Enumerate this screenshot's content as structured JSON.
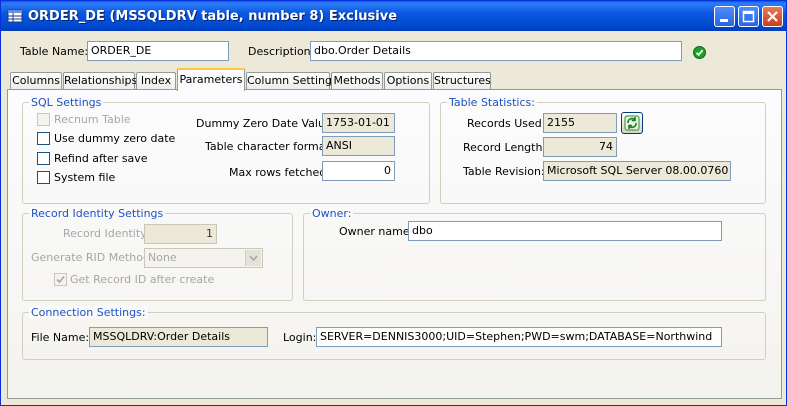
{
  "window": {
    "title": "ORDER_DE  (MSSQLDRV table, number 8)  Exclusive",
    "icon": "table-icon",
    "controls": [
      "minimize-icon",
      "maximize-icon",
      "close-icon"
    ]
  },
  "header": {
    "table_name_label": "Table Name:",
    "table_name_value": "ORDER_DE",
    "description_label": "Description:",
    "description_value": "dbo.Order Details",
    "status_icon": "check-circle-icon",
    "status_color": "#1E9E2A"
  },
  "tabs": [
    {
      "label": "Columns"
    },
    {
      "label": "Relationships"
    },
    {
      "label": "Index"
    },
    {
      "label": "Parameters",
      "active": true
    },
    {
      "label": "Column Settings"
    },
    {
      "label": "Methods"
    },
    {
      "label": "Options"
    },
    {
      "label": "Structures"
    }
  ],
  "sql_settings": {
    "title": "SQL Settings",
    "recnum_table": {
      "label": "Recnum Table",
      "checked": false,
      "disabled": true
    },
    "use_dummy_zero_date": {
      "label": "Use dummy zero date",
      "checked": false
    },
    "refind_after_save": {
      "label": "Refind after save",
      "checked": false
    },
    "system_file": {
      "label": "System file",
      "checked": false
    },
    "dummy_zero_date_label": "Dummy Zero Date Value:",
    "dummy_zero_date_value": "1753-01-01",
    "table_char_format_label": "Table character format:",
    "table_char_format_value": "ANSI",
    "max_rows_label": "Max rows fetched:",
    "max_rows_value": "0"
  },
  "table_statistics": {
    "title": "Table Statistics:",
    "records_used_label": "Records Used:",
    "records_used_value": "2155",
    "refresh_icon": "refresh-icon",
    "record_length_label": "Record Length:",
    "record_length_value": "74",
    "table_revision_label": "Table Revision:",
    "table_revision_value": "Microsoft SQL Server 08.00.0760"
  },
  "record_identity": {
    "title": "Record Identity Settings",
    "record_identity_label": "Record Identity:",
    "record_identity_value": "1",
    "generate_rid_label": "Generate RID Method",
    "generate_rid_value": "None",
    "get_record_id": {
      "label": "Get Record ID after create",
      "checked": true,
      "disabled": true
    }
  },
  "owner": {
    "title": "Owner:",
    "owner_name_label": "Owner name:",
    "owner_name_value": "dbo"
  },
  "connection": {
    "title": "Connection Settings:",
    "file_name_label": "File Name:",
    "file_name_value": "MSSQLDRV:Order Details",
    "login_label": "Login:",
    "login_value": "SERVER=DENNIS3000;UID=Stephen;PWD=swm;DATABASE=Northwind"
  }
}
